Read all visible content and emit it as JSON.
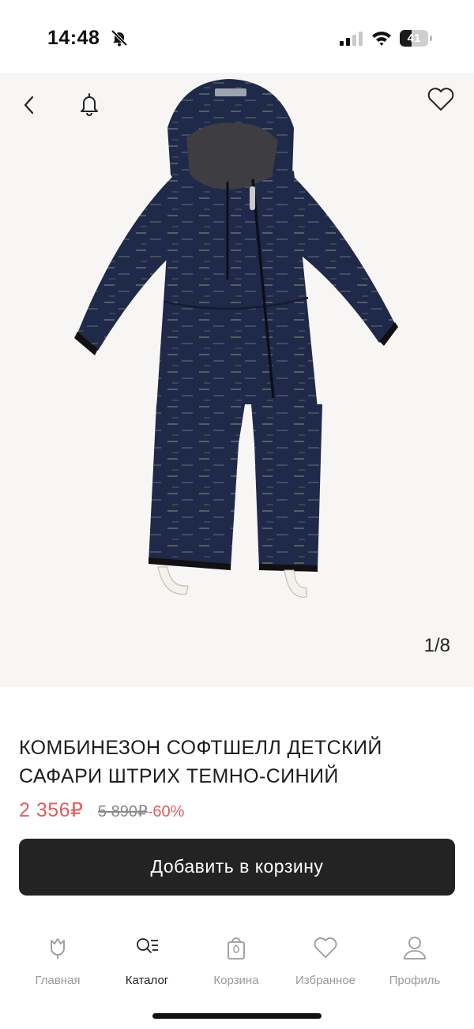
{
  "status_bar": {
    "time": "14:48",
    "battery": "41",
    "battery_level": 0.41
  },
  "gallery": {
    "counter": "1/8"
  },
  "product": {
    "title": "КОМБИНЕЗОН СОФТШЕЛЛ ДЕТСКИЙ САФАРИ ШТРИХ ТЕМНО-СИНИЙ",
    "price": "2 356₽",
    "old_price": "5 890₽",
    "discount": "-60%",
    "add_to_cart": "Добавить в корзину"
  },
  "tabs": [
    {
      "label": "Главная",
      "icon": "tulip-icon",
      "active": false
    },
    {
      "label": "Каталог",
      "icon": "catalog-search-icon",
      "active": true
    },
    {
      "label": "Корзина",
      "icon": "shopping-bag-icon",
      "active": false
    },
    {
      "label": "Избранное",
      "icon": "heart-icon",
      "active": false
    },
    {
      "label": "Профиль",
      "icon": "user-icon",
      "active": false
    }
  ],
  "colors": {
    "price": "#e35d5d",
    "button": "#232323",
    "garment": "#1f2a4a"
  }
}
